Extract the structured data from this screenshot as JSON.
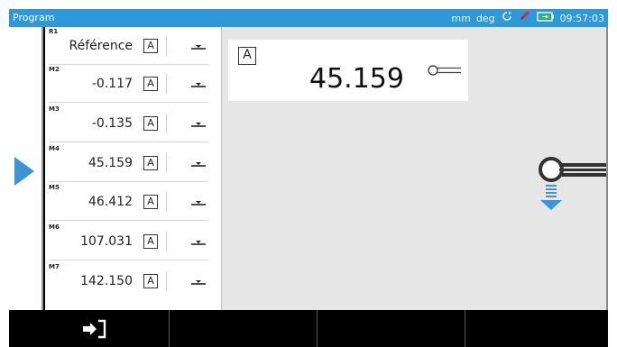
{
  "titlebar": {
    "title": "Program",
    "units_length": "mm",
    "units_angle": "deg",
    "time": "09:57:03",
    "color": "#2f98d8"
  },
  "measurements": [
    {
      "id": "R1",
      "value": "Référence",
      "mode": "A"
    },
    {
      "id": "M2",
      "value": "-0.117",
      "mode": "A"
    },
    {
      "id": "M3",
      "value": "-0.135",
      "mode": "A"
    },
    {
      "id": "M4",
      "value": "45.159",
      "mode": "A"
    },
    {
      "id": "M5",
      "value": "46.412",
      "mode": "A"
    },
    {
      "id": "M6",
      "value": "107.031",
      "mode": "A"
    },
    {
      "id": "M7",
      "value": "142.150",
      "mode": "A"
    }
  ],
  "readout": {
    "mode": "A",
    "value": "45.159"
  },
  "icons": {
    "selector": "play-arrow-icon",
    "row_command": "probe-down-icon",
    "readout_probe": "probe-icon",
    "big_probe": "probe-move-down-icon",
    "exit": "exit-icon"
  },
  "accent_color": "#3a94d6"
}
